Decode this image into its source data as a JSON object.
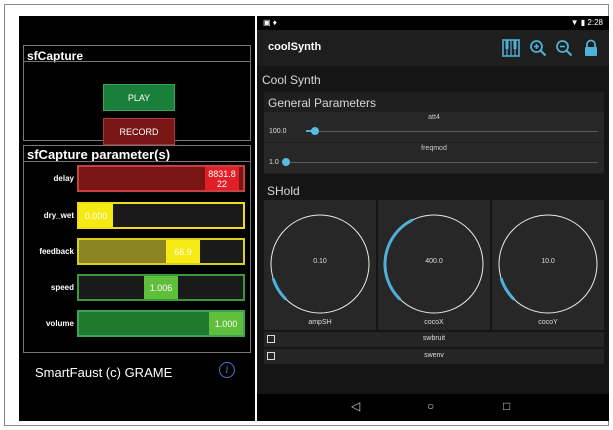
{
  "left_app": {
    "top_panel_title": "sfCapture",
    "play_label": "PLAY",
    "record_label": "RECORD",
    "params_title": "sfCapture parameter(s)",
    "params": [
      {
        "name": "delay",
        "value": "8831.8\n22",
        "level": 0.97,
        "bg": "#7a1515",
        "fill": "#e21f26",
        "border": "#c84040"
      },
      {
        "name": "dry_wet",
        "value": "0.000",
        "level": 0.0,
        "bg": "#1a1a1a",
        "fill": "#f5ea13",
        "border": "#f0dd16"
      },
      {
        "name": "feedback",
        "value": "66.9",
        "level": 0.67,
        "bg": "#1a1a1a",
        "fill": "#f5ea13",
        "border": "#d8d020"
      },
      {
        "name": "speed",
        "value": "1.006",
        "level": 0.5,
        "bg": "#1a1a1a",
        "fill": "#5fbf3b",
        "border": "#3a9a3a"
      },
      {
        "name": "volume",
        "value": "1.000",
        "level": 1.0,
        "bg": "#1f7a2f",
        "fill": "#5fbf3b",
        "border": "#3aa45a"
      }
    ],
    "footer": "SmartFaust (c) GRAME",
    "info_glyph": "i"
  },
  "right_app": {
    "status_time": "2:28",
    "app_title": "coolSynth",
    "section_title": "Cool Synth",
    "general_title": "General Parameters",
    "sliders": [
      {
        "label": "att4",
        "value": "100.0",
        "level": 0.03
      },
      {
        "label": "freqmod",
        "value": "1.0",
        "level": 0.0
      }
    ],
    "shold_title": "SHold",
    "knobs": [
      {
        "name": "ampSH",
        "value": "0.10",
        "level": 0.1
      },
      {
        "name": "cocoX",
        "value": "400.0",
        "level": 0.4
      },
      {
        "name": "cocoY",
        "value": "10.0",
        "level": 0.1
      }
    ],
    "checkboxes": [
      {
        "label": "swbruit",
        "checked": false
      },
      {
        "label": "swenv",
        "checked": false
      }
    ],
    "accent_color": "#4fb0d8"
  }
}
